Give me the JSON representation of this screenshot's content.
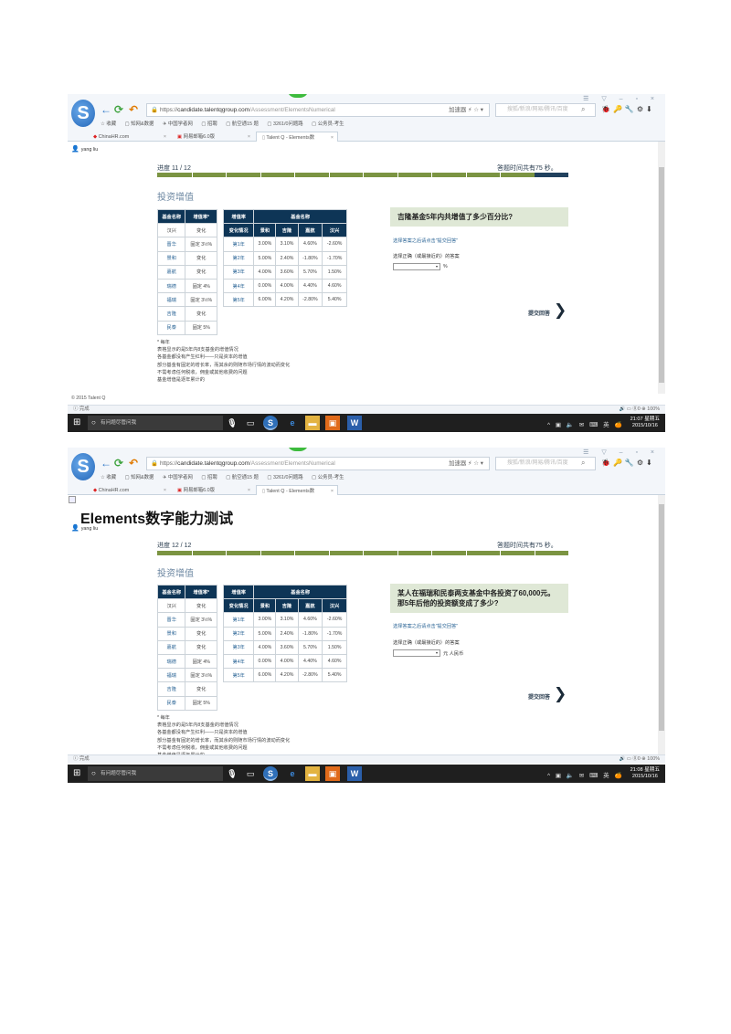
{
  "browser": {
    "url_scheme": "https://",
    "url_host": "candidate.talentqgroup.com",
    "url_path": "/Assessment/ElementsNumerical",
    "addr_side": "加速器  ⚡  ☆  ▾",
    "search_placeholder": "搜狐/新浪/网易/腾讯/百度",
    "bookmarks": [
      "☆ 收藏",
      "▢ 知网&数据",
      "✈ 中国学者网",
      "▢ 招聘",
      "▢ 航空通15 题",
      "▢ 3261/0问题路",
      "▢ 公务员-考生"
    ],
    "tabs": [
      "ChinaHR.com",
      "网易邮箱6.0版",
      "Talent Q - Elements数"
    ],
    "toolbar_icons": "🐞🔑🔧⚙⬇",
    "window_controls": "☰ ▽ – ▫ ×"
  },
  "user": "yang liu",
  "page_title": "Elements数字能力测试",
  "section_title": "投资增值",
  "timer_text": "答题时间共有75 秒。",
  "screens": [
    {
      "progress_label": "进度 11 / 12",
      "question": "吉隆基金5年内共增值了多少百分比?",
      "unit": "%",
      "progress": 0.917
    },
    {
      "progress_label": "进度 12 / 12",
      "question": "某人在福瑞和民泰两支基金中各投资了60,000元。那5年后他的投资额变成了多少?",
      "unit": "元 人民币",
      "progress": 1.0
    }
  ],
  "fund_table": {
    "headers": [
      "基金名称",
      "增值率*"
    ],
    "rows": [
      [
        "汉兴",
        "变化"
      ],
      [
        "晋华",
        "固定 3½%"
      ],
      [
        "景和",
        "变化"
      ],
      [
        "嘉航",
        "变化"
      ],
      [
        "瑞德",
        "固定 4%"
      ],
      [
        "福瑞",
        "固定 3½%"
      ],
      [
        "吉隆",
        "变化"
      ],
      [
        "民泰",
        "固定 5%"
      ]
    ]
  },
  "growth_table": {
    "header_left": "增值率",
    "header_group": "基金名称",
    "sub_left": "变化情况",
    "funds": [
      "景和",
      "吉隆",
      "嘉航",
      "汉兴"
    ],
    "rows": [
      [
        "第1年",
        "3.00%",
        "3.10%",
        "4.60%",
        "-2.60%"
      ],
      [
        "第2年",
        "5.00%",
        "2.40%",
        "-1.80%",
        "-1.70%"
      ],
      [
        "第3年",
        "4.00%",
        "3.60%",
        "5.70%",
        "1.50%"
      ],
      [
        "第4年",
        "0.00%",
        "4.00%",
        "4.40%",
        "4.60%"
      ],
      [
        "第5年",
        "6.00%",
        "4.20%",
        "-2.80%",
        "5.40%"
      ]
    ]
  },
  "notes": [
    "* 每年",
    "表格显示的是5年内8支基金的增值情况",
    "各基金都没有产生红利——只是资本的增值",
    "部分基金有固定的增长率，而其余的则随市场行情的波动而变化",
    "不需考虑任何税收，佣金或其他收费的问题",
    "基金增值是逐年累计的"
  ],
  "hint": "选择答案之后请点击\"提交回答\"",
  "answer_label": "选择正确（或最接近的）的答案",
  "select_value": "▾",
  "submit_label": "提交回答",
  "chevron": "❯",
  "footer_copy": "© 2015 Talent Q",
  "status_left": "ⓘ  完成",
  "status_right": "🔊 ▭  ⓪0  ⊕ 100%",
  "taskbar": {
    "search_text": "有问题尽管问我",
    "tray": "^ ▣ 🔈 ✉ ⌨ 英 🍊",
    "times": [
      [
        "21:07 星期五",
        "2015/10/16"
      ],
      [
        "21:08 星期五",
        "2015/10/16"
      ]
    ]
  },
  "colors": {
    "accent_green": "#7b9442",
    "header_navy": "#0e3556",
    "question_bg": "#dfe8d6",
    "link_blue": "#2b6596"
  }
}
